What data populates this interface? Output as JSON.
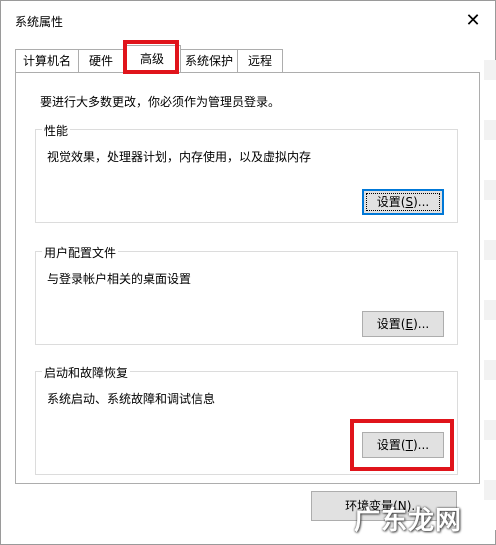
{
  "window": {
    "title": "系统属性",
    "close_glyph": "✕"
  },
  "tabs": [
    {
      "label": "计算机名"
    },
    {
      "label": "硬件"
    },
    {
      "label": "高级"
    },
    {
      "label": "系统保护"
    },
    {
      "label": "远程"
    }
  ],
  "active_tab": "高级",
  "admin_note": "要进行大多数更改，你必须作为管理员登录。",
  "performance": {
    "legend": "性能",
    "description": "视觉效果，处理器计划，内存使用，以及虚拟内存",
    "button_prefix": "设置(",
    "button_key": "S",
    "button_suffix": ")..."
  },
  "user_profiles": {
    "legend": "用户配置文件",
    "description": "与登录帐户相关的桌面设置",
    "button_prefix": "设置(",
    "button_key": "E",
    "button_suffix": ")..."
  },
  "startup_recovery": {
    "legend": "启动和故障恢复",
    "description": "系统启动、系统故障和调试信息",
    "button_prefix": "设置(",
    "button_key": "T",
    "button_suffix": ")..."
  },
  "env_button": {
    "label": "环境变量(N)..."
  },
  "watermark": {
    "text": "广东龙网"
  },
  "colors": {
    "highlight": "#e0141b",
    "focus_border": "#0078d7",
    "button_face": "#e1e1e1"
  }
}
